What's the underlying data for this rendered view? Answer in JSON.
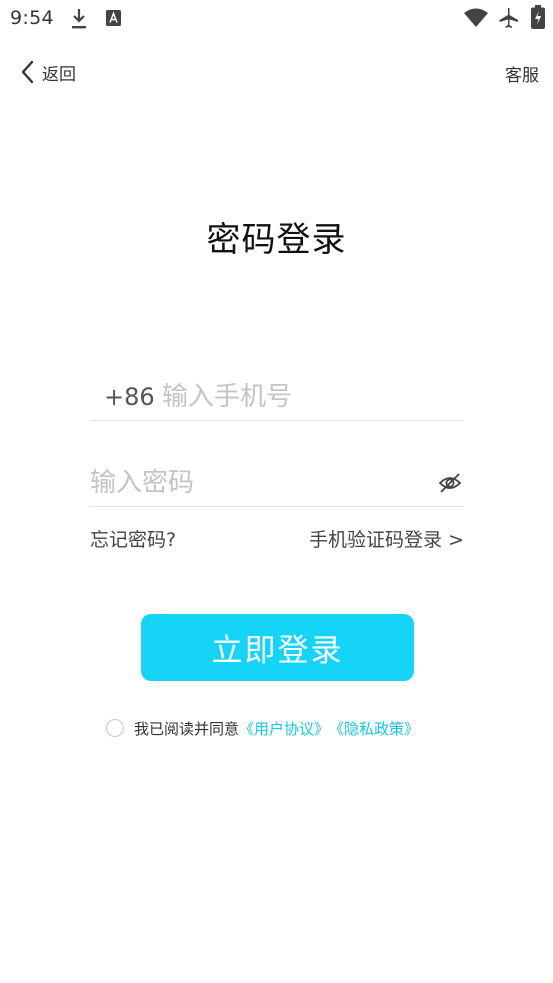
{
  "status_bar": {
    "time": "9:54",
    "icons": [
      "download-icon",
      "text-a-icon",
      "wifi-icon",
      "airplane-icon",
      "battery-icon"
    ]
  },
  "nav": {
    "back_label": "返回",
    "service_label": "客服"
  },
  "title": "密码登录",
  "phone_field": {
    "country_code": "+86",
    "placeholder": "输入手机号",
    "value": ""
  },
  "password_field": {
    "placeholder": "输入密码",
    "value": "",
    "toggle_icon": "eye-off-icon"
  },
  "links": {
    "forgot": "忘记密码?",
    "sms_login": "手机验证码登录 >"
  },
  "login_button": "立即登录",
  "agreement": {
    "checked": false,
    "text": "我已阅读并同意",
    "user_agreement": "《用户协议》",
    "privacy_policy": "《隐私政策》"
  },
  "colors": {
    "accent": "#16d4f5",
    "link": "#16c6e8",
    "placeholder": "#c4c4c4",
    "divider": "#e0e0e0"
  }
}
